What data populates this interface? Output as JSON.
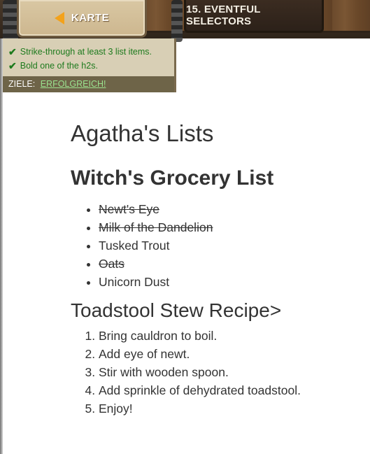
{
  "header": {
    "back_label": "KARTE",
    "level_title": "15. EVENTFUL SELECTORS"
  },
  "goals": {
    "items": [
      "Strike-through at least 3 list items.",
      "Bold one of the h2s."
    ],
    "footer_label": "ZIELE:",
    "status": "ERFOLGREICH!"
  },
  "page": {
    "title": "Agatha's Lists",
    "grocery_heading": "Witch's Grocery List",
    "grocery_items": [
      {
        "text": "Newt's Eye",
        "struck": true
      },
      {
        "text": "Milk of the Dandelion",
        "struck": true
      },
      {
        "text": "Tusked Trout",
        "struck": false
      },
      {
        "text": "Oats",
        "struck": true
      },
      {
        "text": "Unicorn Dust",
        "struck": false
      }
    ],
    "recipe_heading": "Toadstool Stew Recipe>",
    "recipe_steps": [
      "Bring cauldron to boil.",
      "Add eye of newt.",
      "Stir with wooden spoon.",
      "Add sprinkle of dehydrated toadstool.",
      "Enjoy!"
    ]
  },
  "colors": {
    "goal_text": "#1d7a1d",
    "status_text": "#9be38f",
    "arrow": "#f3a21b"
  }
}
